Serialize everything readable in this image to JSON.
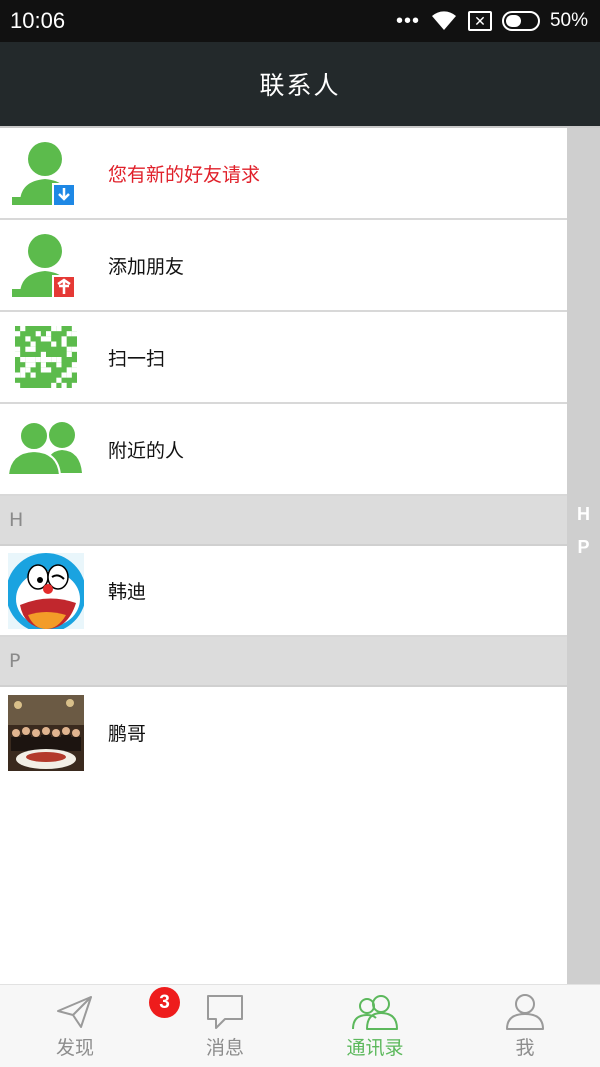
{
  "status_bar": {
    "time": "10:06",
    "dots": "•••",
    "sim_glyph": "✕",
    "battery_text": "50%",
    "battery_level": 0.5
  },
  "header": {
    "title": "联系人"
  },
  "quick_actions": [
    {
      "label": "您有新的好友请求",
      "icon": "friend-request-icon",
      "highlight_color": "#e0202a"
    },
    {
      "label": "添加朋友",
      "icon": "add-friend-icon"
    },
    {
      "label": "扫一扫",
      "icon": "qr-code-icon"
    },
    {
      "label": "附近的人",
      "icon": "people-nearby-icon"
    }
  ],
  "sections": [
    {
      "letter": "H",
      "contacts": [
        {
          "name": "韩迪",
          "avatar": "doraemon-avatar"
        }
      ]
    },
    {
      "letter": "P",
      "contacts": [
        {
          "name": "鹏哥",
          "avatar": "group-photo-avatar"
        }
      ]
    }
  ],
  "index_bar": {
    "letters": [
      "H",
      "P"
    ]
  },
  "bottom_nav": {
    "items": [
      {
        "label": "发现",
        "icon": "paper-plane-icon",
        "active": false
      },
      {
        "label": "消息",
        "icon": "chat-bubble-icon",
        "active": false,
        "badge": "3"
      },
      {
        "label": "通讯录",
        "icon": "contacts-icon",
        "active": true
      },
      {
        "label": "我",
        "icon": "profile-icon",
        "active": false
      }
    ]
  },
  "colors": {
    "accent_green": "#5cb85c",
    "title_bar": "#23292b",
    "badge_red": "#ee1c1c",
    "request_red": "#e0202a"
  }
}
